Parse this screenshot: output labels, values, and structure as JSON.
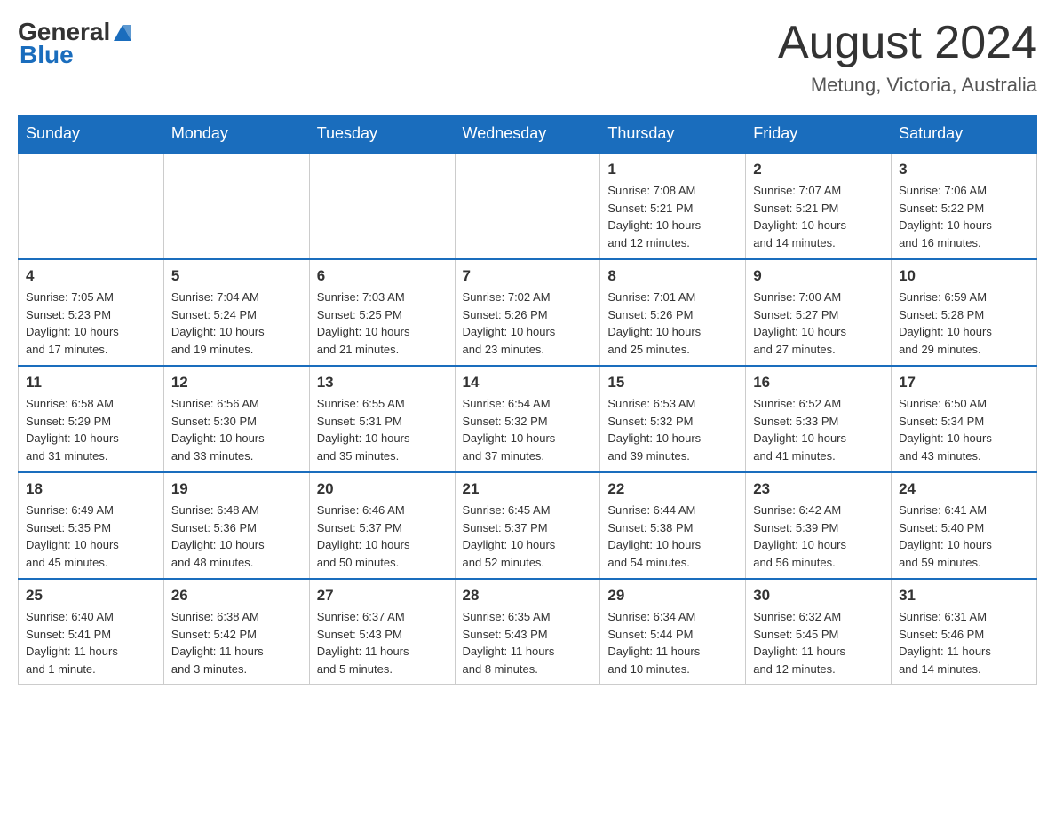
{
  "header": {
    "logo_general": "General",
    "logo_blue": "Blue",
    "month_title": "August 2024",
    "location": "Metung, Victoria, Australia"
  },
  "days_of_week": [
    "Sunday",
    "Monday",
    "Tuesday",
    "Wednesday",
    "Thursday",
    "Friday",
    "Saturday"
  ],
  "weeks": [
    [
      {
        "day": "",
        "info": ""
      },
      {
        "day": "",
        "info": ""
      },
      {
        "day": "",
        "info": ""
      },
      {
        "day": "",
        "info": ""
      },
      {
        "day": "1",
        "info": "Sunrise: 7:08 AM\nSunset: 5:21 PM\nDaylight: 10 hours\nand 12 minutes."
      },
      {
        "day": "2",
        "info": "Sunrise: 7:07 AM\nSunset: 5:21 PM\nDaylight: 10 hours\nand 14 minutes."
      },
      {
        "day": "3",
        "info": "Sunrise: 7:06 AM\nSunset: 5:22 PM\nDaylight: 10 hours\nand 16 minutes."
      }
    ],
    [
      {
        "day": "4",
        "info": "Sunrise: 7:05 AM\nSunset: 5:23 PM\nDaylight: 10 hours\nand 17 minutes."
      },
      {
        "day": "5",
        "info": "Sunrise: 7:04 AM\nSunset: 5:24 PM\nDaylight: 10 hours\nand 19 minutes."
      },
      {
        "day": "6",
        "info": "Sunrise: 7:03 AM\nSunset: 5:25 PM\nDaylight: 10 hours\nand 21 minutes."
      },
      {
        "day": "7",
        "info": "Sunrise: 7:02 AM\nSunset: 5:26 PM\nDaylight: 10 hours\nand 23 minutes."
      },
      {
        "day": "8",
        "info": "Sunrise: 7:01 AM\nSunset: 5:26 PM\nDaylight: 10 hours\nand 25 minutes."
      },
      {
        "day": "9",
        "info": "Sunrise: 7:00 AM\nSunset: 5:27 PM\nDaylight: 10 hours\nand 27 minutes."
      },
      {
        "day": "10",
        "info": "Sunrise: 6:59 AM\nSunset: 5:28 PM\nDaylight: 10 hours\nand 29 minutes."
      }
    ],
    [
      {
        "day": "11",
        "info": "Sunrise: 6:58 AM\nSunset: 5:29 PM\nDaylight: 10 hours\nand 31 minutes."
      },
      {
        "day": "12",
        "info": "Sunrise: 6:56 AM\nSunset: 5:30 PM\nDaylight: 10 hours\nand 33 minutes."
      },
      {
        "day": "13",
        "info": "Sunrise: 6:55 AM\nSunset: 5:31 PM\nDaylight: 10 hours\nand 35 minutes."
      },
      {
        "day": "14",
        "info": "Sunrise: 6:54 AM\nSunset: 5:32 PM\nDaylight: 10 hours\nand 37 minutes."
      },
      {
        "day": "15",
        "info": "Sunrise: 6:53 AM\nSunset: 5:32 PM\nDaylight: 10 hours\nand 39 minutes."
      },
      {
        "day": "16",
        "info": "Sunrise: 6:52 AM\nSunset: 5:33 PM\nDaylight: 10 hours\nand 41 minutes."
      },
      {
        "day": "17",
        "info": "Sunrise: 6:50 AM\nSunset: 5:34 PM\nDaylight: 10 hours\nand 43 minutes."
      }
    ],
    [
      {
        "day": "18",
        "info": "Sunrise: 6:49 AM\nSunset: 5:35 PM\nDaylight: 10 hours\nand 45 minutes."
      },
      {
        "day": "19",
        "info": "Sunrise: 6:48 AM\nSunset: 5:36 PM\nDaylight: 10 hours\nand 48 minutes."
      },
      {
        "day": "20",
        "info": "Sunrise: 6:46 AM\nSunset: 5:37 PM\nDaylight: 10 hours\nand 50 minutes."
      },
      {
        "day": "21",
        "info": "Sunrise: 6:45 AM\nSunset: 5:37 PM\nDaylight: 10 hours\nand 52 minutes."
      },
      {
        "day": "22",
        "info": "Sunrise: 6:44 AM\nSunset: 5:38 PM\nDaylight: 10 hours\nand 54 minutes."
      },
      {
        "day": "23",
        "info": "Sunrise: 6:42 AM\nSunset: 5:39 PM\nDaylight: 10 hours\nand 56 minutes."
      },
      {
        "day": "24",
        "info": "Sunrise: 6:41 AM\nSunset: 5:40 PM\nDaylight: 10 hours\nand 59 minutes."
      }
    ],
    [
      {
        "day": "25",
        "info": "Sunrise: 6:40 AM\nSunset: 5:41 PM\nDaylight: 11 hours\nand 1 minute."
      },
      {
        "day": "26",
        "info": "Sunrise: 6:38 AM\nSunset: 5:42 PM\nDaylight: 11 hours\nand 3 minutes."
      },
      {
        "day": "27",
        "info": "Sunrise: 6:37 AM\nSunset: 5:43 PM\nDaylight: 11 hours\nand 5 minutes."
      },
      {
        "day": "28",
        "info": "Sunrise: 6:35 AM\nSunset: 5:43 PM\nDaylight: 11 hours\nand 8 minutes."
      },
      {
        "day": "29",
        "info": "Sunrise: 6:34 AM\nSunset: 5:44 PM\nDaylight: 11 hours\nand 10 minutes."
      },
      {
        "day": "30",
        "info": "Sunrise: 6:32 AM\nSunset: 5:45 PM\nDaylight: 11 hours\nand 12 minutes."
      },
      {
        "day": "31",
        "info": "Sunrise: 6:31 AM\nSunset: 5:46 PM\nDaylight: 11 hours\nand 14 minutes."
      }
    ]
  ]
}
